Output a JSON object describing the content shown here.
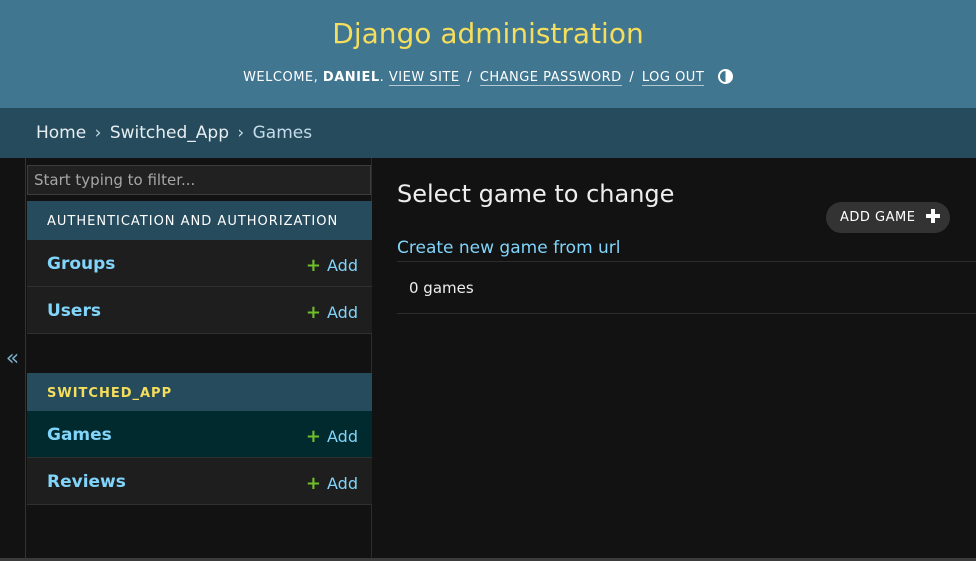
{
  "header": {
    "site_name": "Django administration",
    "welcome": "WELCOME,",
    "username": "DANIEL",
    "view_site": "VIEW SITE",
    "change_password": "CHANGE PASSWORD",
    "log_out": "LOG OUT",
    "separator": "/"
  },
  "breadcrumbs": {
    "home": "Home",
    "app": "Switched_App",
    "current": "Games",
    "separator": "›"
  },
  "sidebar": {
    "toggle": "«",
    "filter_placeholder": "Start typing to filter...",
    "add_label": "Add",
    "modules": [
      {
        "caption": "AUTHENTICATION AND AUTHORIZATION",
        "models": [
          {
            "name": "Groups"
          },
          {
            "name": "Users"
          }
        ]
      },
      {
        "caption": "SWITCHED_APP",
        "models": [
          {
            "name": "Games",
            "current": true
          },
          {
            "name": "Reviews"
          }
        ]
      }
    ]
  },
  "content": {
    "title": "Select game to change",
    "add_button": "ADD GAME",
    "create_link": "Create new game from url",
    "result_count": "0 games"
  },
  "colors": {
    "header_bg": "#417690",
    "site_name": "#f5dd5d",
    "breadcrumbs_bg": "#264b5d",
    "link": "#81d4fa",
    "add_plus": "#70bf2b",
    "current_row": "#002a2e"
  }
}
